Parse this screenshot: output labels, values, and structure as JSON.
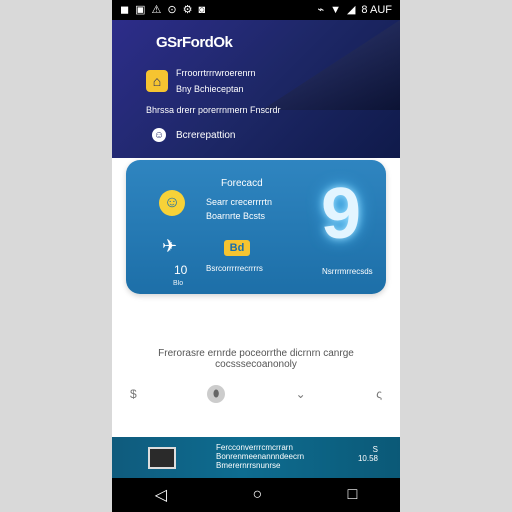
{
  "status_bar": {
    "left_glyphs": [
      "◼",
      "▣",
      "⚠",
      "⊙",
      "⚙",
      "◙"
    ],
    "right_text": "8 AUF",
    "right_glyphs": [
      "⌁",
      "▼",
      "◢"
    ]
  },
  "header": {
    "brand": "GSrFordOk",
    "row1_line1": "Frroorrtrrrwroerenrn",
    "row1_line2": "Bny Bchieceptan",
    "row2": "Bhrssa drerr porerrnmern Fnscrdr",
    "row3_label": "Bcrerepattion"
  },
  "card": {
    "title": "Forecacd",
    "desc_line1": "Searr crecerrrrtn",
    "desc_line2": "Boarnrte Bcsts",
    "key_glyph": "✈",
    "badge_text": "Bd",
    "count": "10",
    "substat": "Blo",
    "progress_text": "Bsrcorrrrrecrrrrs",
    "big_number": "9",
    "right_label": "Nsrrrmrrecsds"
  },
  "body_text": "Frerorasre ernrde poceorrthe dicrnrn canrge cocsssecoanonoly",
  "icons": [
    "$",
    "⬮",
    "⌄",
    "ς"
  ],
  "banner": {
    "line1": "Fercconverrrcmcrrarn",
    "line2": "Bonrenmeenannndeecrn",
    "line3": "Bmerernrrsnunrse",
    "stat_top": "S",
    "stat_value": "10.58"
  },
  "navbar": {
    "back": "◁",
    "home": "○",
    "recents": "□"
  }
}
